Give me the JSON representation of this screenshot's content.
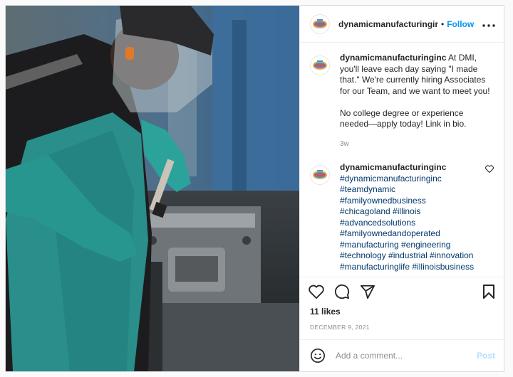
{
  "post": {
    "username": "dynamicmanufacturinginc",
    "header_username": "dynamicmanufacturinginc",
    "separator": "•",
    "follow_label": "Follow",
    "more_icon": "more-horizontal-icon",
    "caption": "At DMI, you'll leave each day saying \"I made that.\" We're currently hiring Associates for our Team, and we want to meet you!",
    "caption_2": "No college degree or experience needed—apply today! Link in bio.",
    "caption_time": "3w",
    "likes": "11 likes",
    "date": "DECEMBER 9, 2021"
  },
  "comment": {
    "username": "dynamicmanufacturinginc",
    "hashtags": [
      "#dynamicmanufacturinginc",
      "#teamdynamic",
      "#familyownedbusiness",
      "#chicagoland #illinois",
      "#advancedsolutions",
      "#familyownedandoperated",
      "#manufacturing #engineering",
      "#technology #industrial #innovation",
      "#manufacturinglife #illinoisbusiness"
    ]
  },
  "add_comment": {
    "placeholder": "Add a comment...",
    "post_label": "Post"
  },
  "colors": {
    "accent": "#0095f6",
    "post_disabled": "#b2dffc",
    "hashtag": "#00376b",
    "muted": "#8e8e8e"
  }
}
